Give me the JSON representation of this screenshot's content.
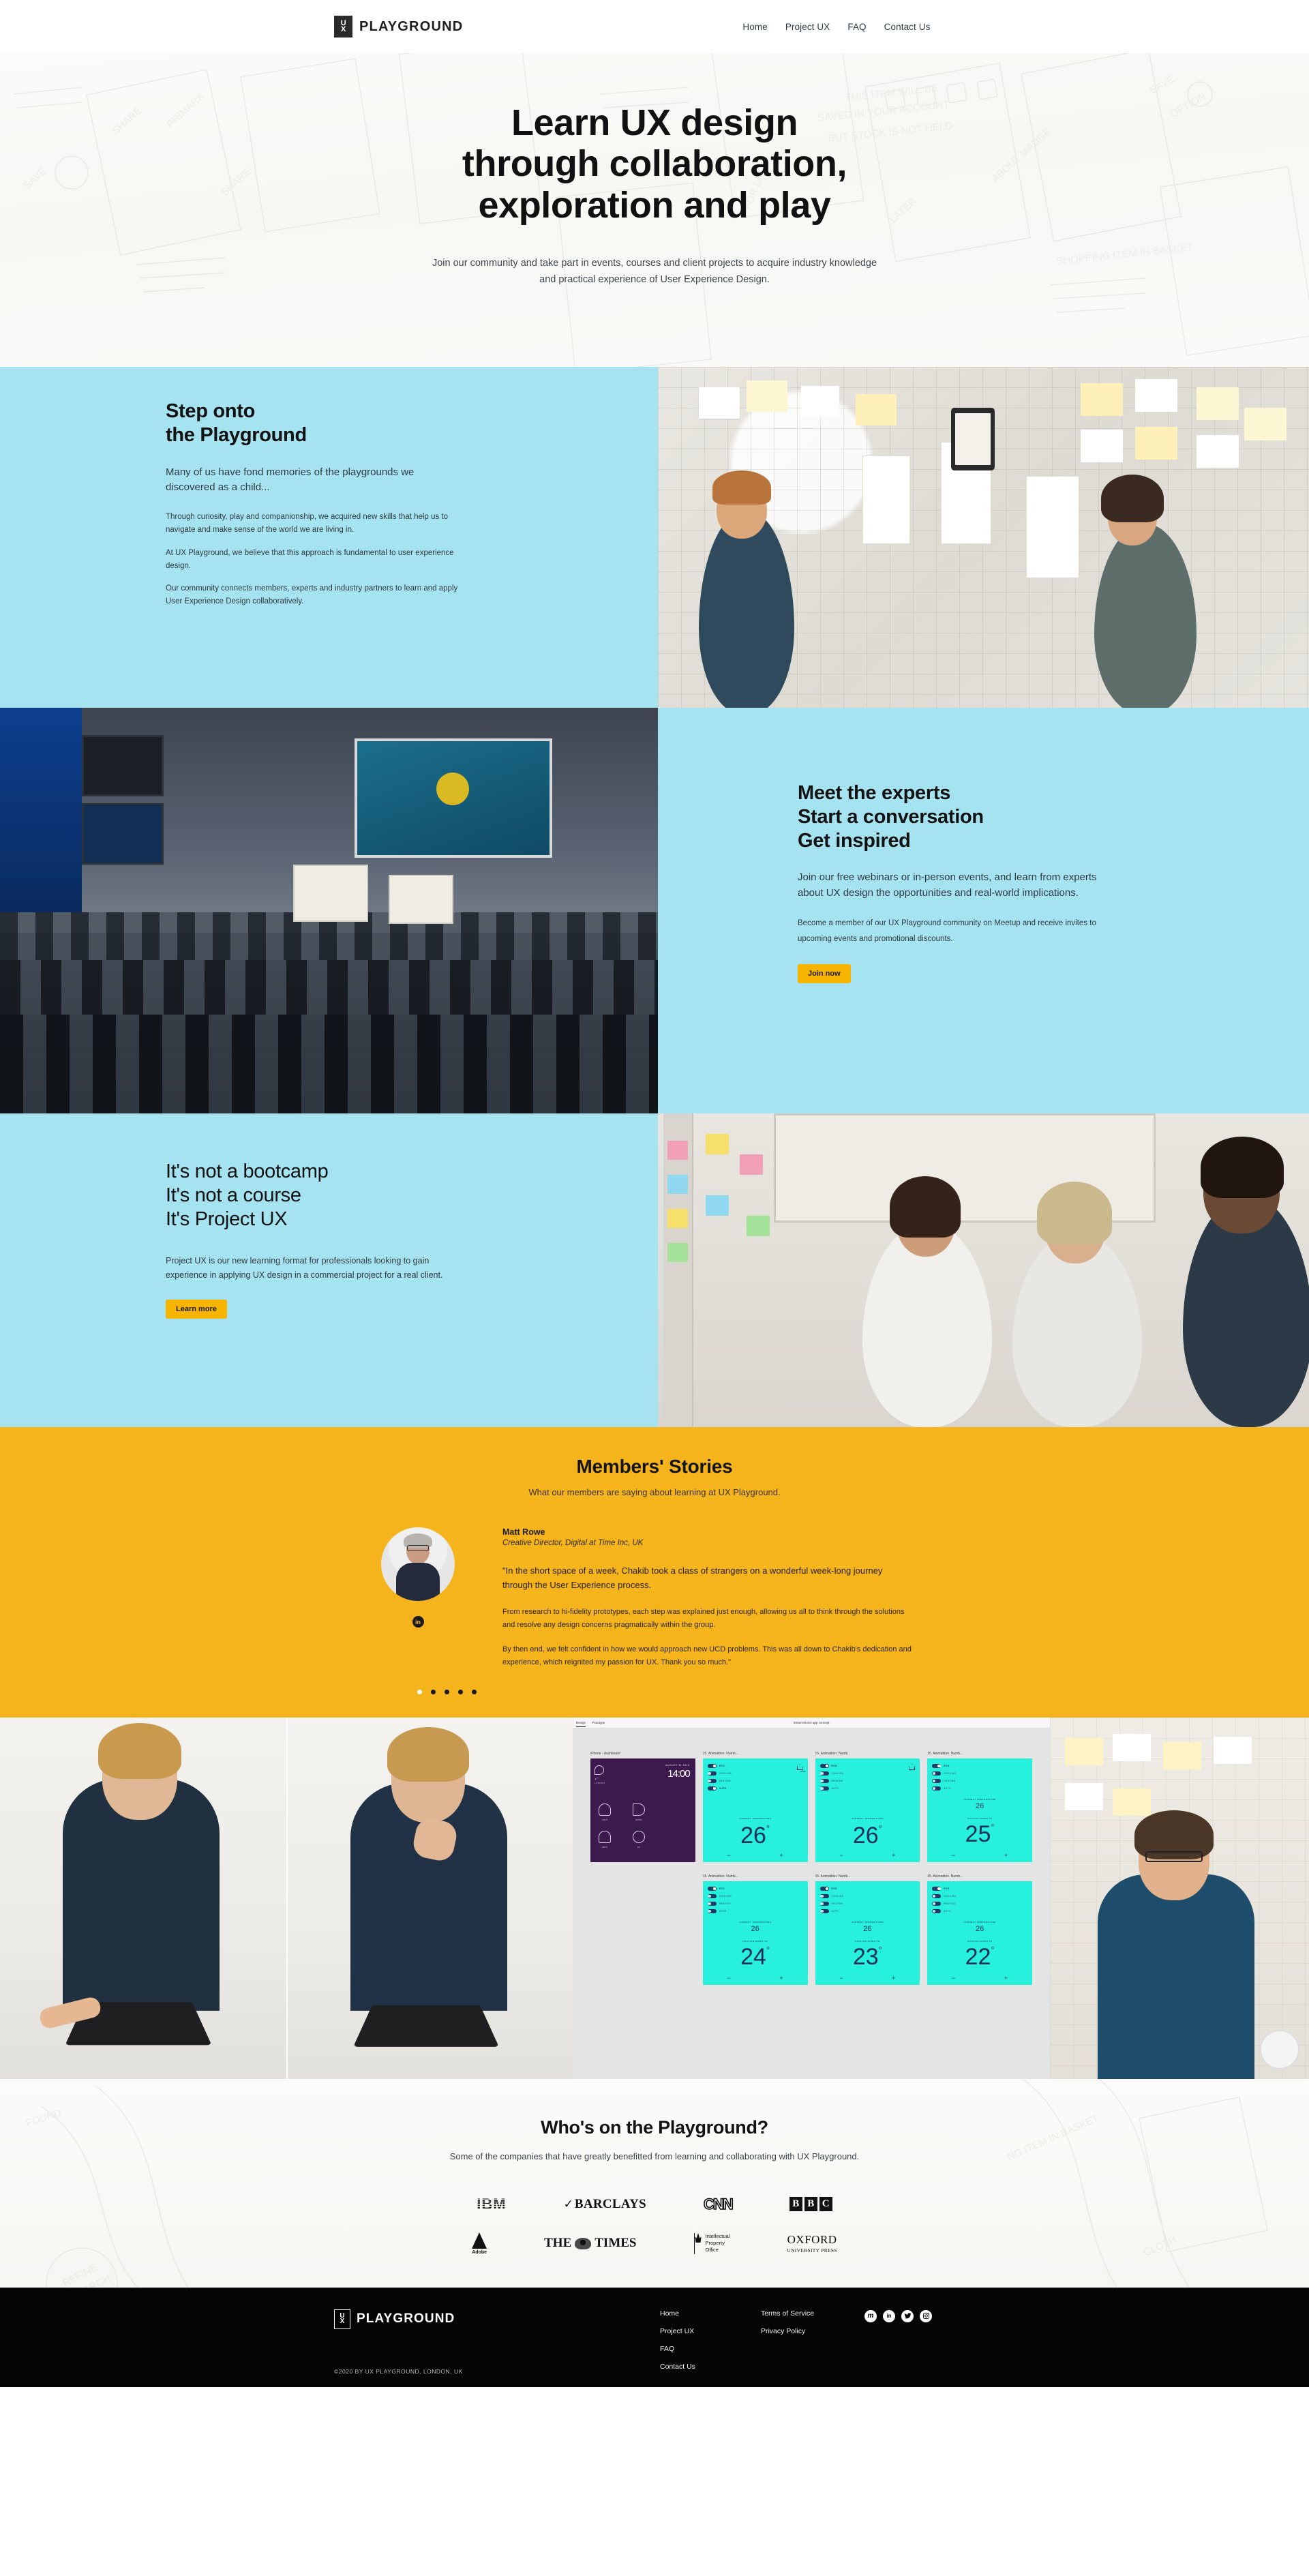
{
  "header": {
    "logo": {
      "mark_top": "U",
      "mark_bottom": "X",
      "word": "PLAYGROUND"
    },
    "nav": [
      {
        "label": "Home"
      },
      {
        "label": "Project UX"
      },
      {
        "label": "FAQ"
      },
      {
        "label": "Contact Us"
      }
    ]
  },
  "hero": {
    "line1": "Learn UX design",
    "line2": "through collaboration,",
    "line3": "exploration and play",
    "subtitle": "Join our community and take part in events, courses and client projects to acquire industry knowledge and practical experience of User Experience Design."
  },
  "section_playground": {
    "title_line1": "Step onto",
    "title_line2": "the Playground",
    "lead": "Many of us have fond memories of the playgrounds we discovered as a child...",
    "p1": "Through curiosity, play and companionship, we acquired new skills that help us to navigate and make sense of the world we are living in.",
    "p2": "At UX Playground, we believe that this approach is fundamental to user experience design.",
    "p3": "Our community connects members, experts and industry partners to learn and apply User Experience Design collaboratively."
  },
  "section_experts": {
    "title_line1": "Meet the experts",
    "title_line2": "Start a conversation",
    "title_line3": "Get inspired",
    "lead": "Join our free webinars or in-person events, and learn from experts about UX design the opportunities and real-world implications.",
    "p1": "Become a member of our UX Playground community on Meetup and receive invites to upcoming events and promotional discounts.",
    "cta": "Join now"
  },
  "section_projectux": {
    "title_line1": "It's not a bootcamp",
    "title_line2": "It's not a course",
    "title_line3": "It's Project UX",
    "p1": "Project UX is our new learning format for professionals looking to gain experience in applying UX design in a commercial project for a real client.",
    "cta": "Learn more"
  },
  "members": {
    "title": "Members' Stories",
    "subtitle": "What our members are saying about learning at UX Playground.",
    "testimonial": {
      "name": "Matt Rowe",
      "role": "Creative Director, Digital at Time Inc, UK",
      "quote_lead": "\"In the short space of a week, Chakib took a class of strangers on a wonderful week-long journey through the User Experience process.",
      "quote_p1": "From research to hi-fidelity prototypes, each step was explained just enough, allowing us all to think through the solutions and resolve any design concerns pragmatically within the group.",
      "quote_p2": "By then end, we felt confident in how we would approach new UCD problems. This was all down to Chakib's dedication and experience, which reignited my passion for UX. Thank you so much.\"",
      "social_icon": "linkedin-icon"
    },
    "carousel": {
      "count": 5,
      "active_index": 0
    }
  },
  "gallery": {
    "figma": {
      "tab_design": "Design",
      "tab_prototype": "Prototype",
      "file_title": "Smart Device app concept",
      "frames": [
        {
          "label": "iPhone - dashboard",
          "type": "dashboard",
          "date": "AUGUST 31 2018",
          "time": "14:00",
          "city": "LONDON",
          "temp_out": "17°",
          "tiles": [
            "LIGHT",
            "MUSIC",
            "KEYS",
            "AC"
          ]
        },
        {
          "label": "15. Animattion. Numb...",
          "type": "temp",
          "current": "",
          "current_label": "CURRENT TEMPERATURE",
          "big": "26",
          "degree": "°",
          "sub": ""
        },
        {
          "label": "15. Animattion. Numb...",
          "type": "temp",
          "current": "",
          "current_label": "CURRENT TEMPERATURE",
          "big": "26",
          "degree": "°",
          "sub": ""
        },
        {
          "label": "15. Animattion. Numb...",
          "type": "temp",
          "current": "26",
          "current_label": "CURRENT TEMPERATURE",
          "big": "25",
          "degree": "°",
          "sub": "COOLING DOWN TO"
        },
        {
          "label": "15. Animattion. Numb...",
          "type": "temp",
          "current": "26",
          "current_label": "CURRENT TEMPERATURE",
          "big": "24",
          "degree": "°",
          "sub": "COOLING DOWN TO"
        },
        {
          "label": "15. Animattion. Numb...",
          "type": "temp",
          "current": "26",
          "current_label": "CURRENT TEMPERATURE",
          "big": "23",
          "degree": "°",
          "sub": "COOLING DOWN TO"
        },
        {
          "label": "15. Animattion. Numb...",
          "type": "temp",
          "current": "26",
          "current_label": "CURRENT TEMPERATURE",
          "big": "22",
          "degree": "°",
          "sub": "COOLING DOWN TO"
        }
      ],
      "toggles": [
        "ECO",
        "COOLING",
        "HEATING",
        "AUTO"
      ],
      "home_label": "HOME"
    }
  },
  "whos": {
    "title": "Who's on the Playground?",
    "subtitle": "Some of the companies that have greatly benefitted from learning and collaborating with UX Playground.",
    "logos_row1": [
      {
        "name": "IBM",
        "text": "IBM"
      },
      {
        "name": "Barclays",
        "text": "BARCLAYS"
      },
      {
        "name": "CNN",
        "text": "CNN"
      },
      {
        "name": "BBC",
        "text": "BBC"
      }
    ],
    "logos_row2": [
      {
        "name": "Adobe",
        "text": "Adobe"
      },
      {
        "name": "The Times",
        "text": "THE TIMES"
      },
      {
        "name": "Intellectual Property Office",
        "line1": "Intellectual",
        "line2": "Property",
        "line3": "Office"
      },
      {
        "name": "Oxford University Press",
        "line1": "OXFORD",
        "line2": "UNIVERSITY PRESS"
      }
    ]
  },
  "footer": {
    "logo": {
      "mark_top": "U",
      "mark_bottom": "X",
      "word": "PLAYGROUND"
    },
    "col1": [
      {
        "label": "Home"
      },
      {
        "label": "Project UX"
      },
      {
        "label": "FAQ"
      },
      {
        "label": "Contact Us"
      }
    ],
    "col2": [
      {
        "label": "Terms of Service"
      },
      {
        "label": "Privacy Policy"
      }
    ],
    "socials": [
      {
        "name": "meetup-icon",
        "glyph": "m"
      },
      {
        "name": "linkedin-icon",
        "glyph": "in"
      },
      {
        "name": "twitter-icon",
        "glyph": "✈"
      },
      {
        "name": "instagram-icon",
        "glyph": "□"
      }
    ],
    "copyright": "©2020 BY UX PLAYGROUND, LONDON, UK"
  },
  "colors": {
    "cyan": "#a6e3f0",
    "yellow": "#f5b31c",
    "button_yellow": "#f7b500",
    "dark": "#050505",
    "teal_screen": "#27f0dd"
  }
}
